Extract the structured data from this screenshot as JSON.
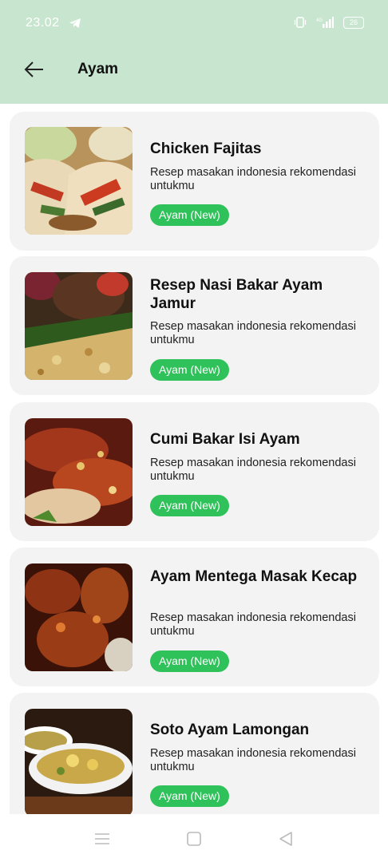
{
  "status_bar": {
    "time": "23.02",
    "network": "4G",
    "battery": "26"
  },
  "app_bar": {
    "title": "Ayam"
  },
  "recipes": [
    {
      "title": "Chicken Fajitas",
      "description": "Resep masakan indonesia rekomendasi untukmu",
      "badge": "Ayam (New)"
    },
    {
      "title": "Resep Nasi Bakar Ayam Jamur",
      "description": "Resep masakan indonesia rekomendasi untukmu",
      "badge": "Ayam (New)"
    },
    {
      "title": "Cumi Bakar Isi Ayam",
      "description": "Resep masakan indonesia rekomendasi untukmu",
      "badge": "Ayam (New)"
    },
    {
      "title": "Ayam Mentega Masak Kecap",
      "description": "Resep masakan indonesia rekomendasi untukmu",
      "badge": "Ayam (New)"
    },
    {
      "title": "Soto Ayam Lamongan",
      "description": "Resep masakan indonesia rekomendasi untukmu",
      "badge": "Ayam (New)"
    }
  ],
  "colors": {
    "header": "#c8e6cf",
    "badge": "#2fc15a",
    "card": "#f3f3f3"
  },
  "icons": {
    "back": "arrow-left-icon",
    "menu": "menu-icon",
    "home": "square-home-icon",
    "nav_back": "triangle-back-icon"
  }
}
